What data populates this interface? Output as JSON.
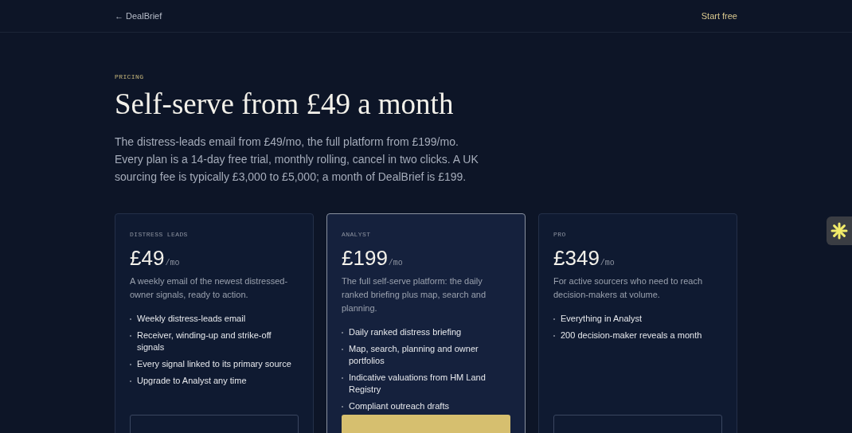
{
  "nav": {
    "back_link": "← DealBrief",
    "cta": "Start free"
  },
  "hero": {
    "eyebrow": "PRICING",
    "title": "Self-serve from £49 a month",
    "intro": "The distress-leads email from £49/mo, the full platform from £199/mo. Every plan is a 14-day free trial, monthly rolling, cancel in two clicks. A UK sourcing fee is typically £3,000 to £5,000; a month of DealBrief is £199."
  },
  "plans": [
    {
      "tier": "DISTRESS LEADS",
      "price": "£49",
      "period": "/mo",
      "featured": false,
      "description": "A weekly email of the newest distressed-owner signals, ready to action.",
      "features": [
        "Weekly distress-leads email",
        "Receiver, winding-up and strike-off signals",
        "Every signal linked to its primary source",
        "Upgrade to Analyst any time"
      ]
    },
    {
      "tier": "ANALYST",
      "price": "£199",
      "period": "/mo",
      "featured": true,
      "description": "The full self-serve platform: the daily ranked briefing plus map, search and planning.",
      "features": [
        "Daily ranked distress briefing",
        "Map, search, planning and owner portfolios",
        "Indicative valuations from HM Land Registry",
        "Compliant outreach drafts"
      ]
    },
    {
      "tier": "PRO",
      "price": "£349",
      "period": "/mo",
      "featured": false,
      "description": "For active sourcers who need to reach decision-makers at volume.",
      "features": [
        "Everything in Analyst",
        "200 decision-maker reveals a month"
      ]
    }
  ]
}
